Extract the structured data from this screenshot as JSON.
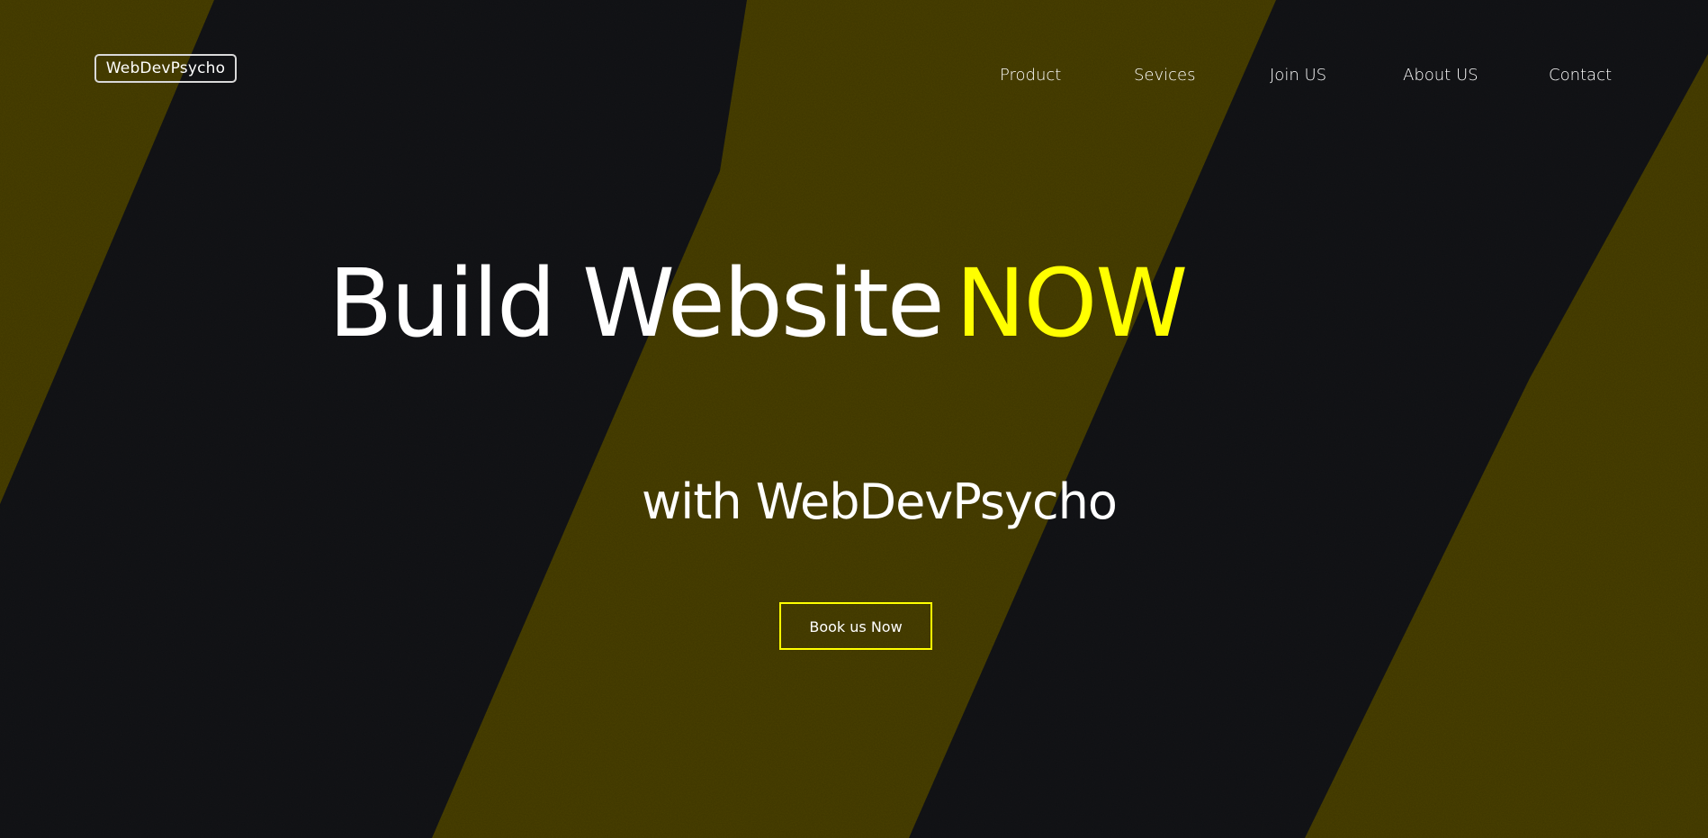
{
  "brand": {
    "logo_text": "WebDevPsycho"
  },
  "nav": {
    "items": [
      {
        "label": "Product"
      },
      {
        "label": "Sevices"
      },
      {
        "label": "Join US"
      },
      {
        "label": "About US"
      },
      {
        "label": "Contact"
      }
    ]
  },
  "hero": {
    "headline_main": "Build Website",
    "headline_accent": "NOW",
    "subheadline": "with WebDevPsycho",
    "cta_label": "Book us Now"
  },
  "colors": {
    "accent": "#ffff00",
    "text": "#ffffff",
    "stripe_dark": "#17181c",
    "stripe_yellow": "#574c00"
  }
}
